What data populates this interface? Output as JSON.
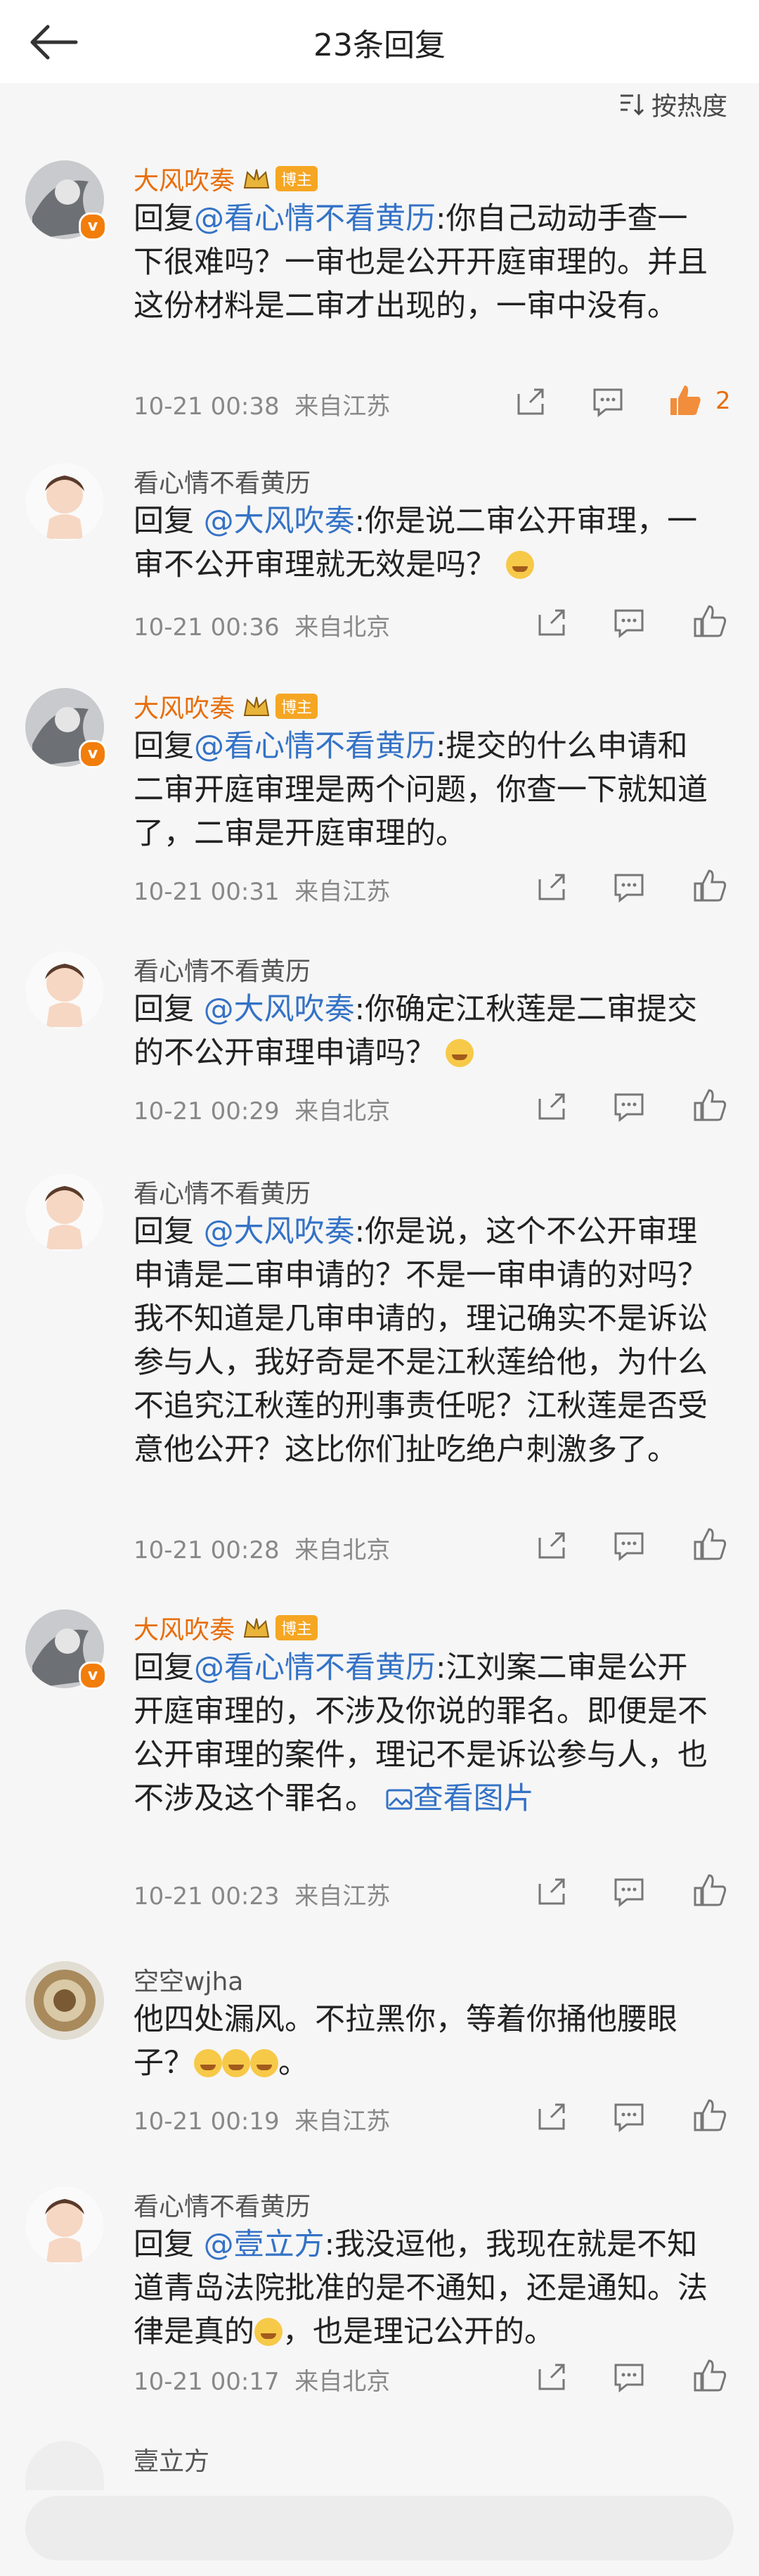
{
  "header": {
    "title": "23条回复",
    "sort_label": "按热度"
  },
  "comments": [
    {
      "username": "大风吹奏",
      "badge": "博主",
      "reply_prefix": "回复",
      "reply_to": "@看心情不看黄历",
      "text": ":你自己动动手查一下很难吗？一审也是公开开庭审理的。并且这份材料是二审才出现的，一审中没有。",
      "time": "10-21 00:38",
      "source": "来自江苏",
      "likes": "2"
    },
    {
      "username": "看心情不看黄历",
      "reply_prefix": "回复 ",
      "reply_to": "@大风吹奏",
      "text": ":你是说二审公开审理，一审不公开审理就无效是吗？",
      "time": "10-21 00:36",
      "source": "来自北京"
    },
    {
      "username": "大风吹奏",
      "badge": "博主",
      "reply_prefix": "回复",
      "reply_to": "@看心情不看黄历",
      "text": ":提交的什么申请和二审开庭审理是两个问题，你查一下就知道了，二审是开庭审理的。",
      "time": "10-21 00:31",
      "source": "来自江苏"
    },
    {
      "username": "看心情不看黄历",
      "reply_prefix": "回复 ",
      "reply_to": "@大风吹奏",
      "text": ":你确定江秋莲是二审提交的不公开审理申请吗？",
      "time": "10-21 00:29",
      "source": "来自北京"
    },
    {
      "username": "看心情不看黄历",
      "reply_prefix": "回复 ",
      "reply_to": "@大风吹奏",
      "text": ":你是说，这个不公开审理申请是二审申请的？不是一审申请的对吗？我不知道是几审申请的，理记确实不是诉讼参与人，我好奇是不是江秋莲给他，为什么不追究江秋莲的刑事责任呢？江秋莲是否受意他公开？这比你们扯吃绝户刺激多了。",
      "time": "10-21 00:28",
      "source": "来自北京"
    },
    {
      "username": "大风吹奏",
      "badge": "博主",
      "reply_prefix": "回复",
      "reply_to": "@看心情不看黄历",
      "text": ":江刘案二审是公开开庭审理的，不涉及你说的罪名。即便是不公开审理的案件，理记不是诉讼参与人，也不涉及这个罪名。",
      "view_image": "查看图片",
      "time": "10-21 00:23",
      "source": "来自江苏"
    },
    {
      "username": "空空wjha",
      "text": "他四处漏风。不拉黑你，等着你捅他腰眼子？",
      "tail": "。",
      "time": "10-21 00:19",
      "source": "来自江苏"
    },
    {
      "username": "看心情不看黄历",
      "reply_prefix": "回复 ",
      "reply_to": "@壹立方",
      "text": ":我没逗他，我现在就是不知道青岛法院批准的是不通知，还是通知。法律是真的",
      "tail": "，也是理记公开的。",
      "time": "10-21 00:17",
      "source": "来自北京"
    },
    {
      "username": "壹立方"
    }
  ],
  "colors": {
    "accent": "#e86e0b",
    "link": "#3472c6",
    "meta": "#888888"
  },
  "icons": [
    "back-arrow-icon",
    "sort-icon",
    "share-icon",
    "comment-icon",
    "like-icon",
    "laugh-emoji",
    "verified-badge-icon",
    "crown-icon",
    "image-icon"
  ]
}
